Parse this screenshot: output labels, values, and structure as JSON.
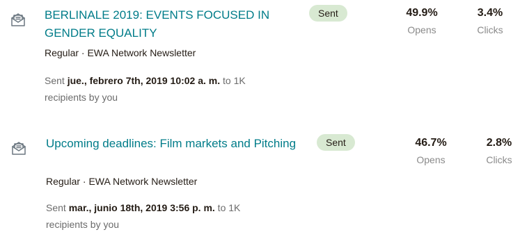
{
  "campaigns": [
    {
      "title": "BERLINALE 2019: EVENTS FOCUSED IN GENDER EQUALITY",
      "meta": "Regular · EWA Network Newsletter",
      "sent_prefix": "Sent ",
      "sent_date": "jue., febrero 7th, 2019 10:02 a. m.",
      "sent_suffix": " to 1K recipients by you",
      "status": "Sent",
      "opens_value": "49.9%",
      "opens_label": "Opens",
      "clicks_value": "3.4%",
      "clicks_label": "Clicks",
      "icon": "email-campaign-icon"
    },
    {
      "title": "Upcoming deadlines: Film markets and Pitching",
      "meta": "Regular · EWA Network Newsletter",
      "sent_prefix": "Sent ",
      "sent_date": "mar., junio 18th, 2019 3:56 p. m.",
      "sent_suffix": " to 1K recipients by you",
      "status": "Sent",
      "opens_value": "46.7%",
      "opens_label": "Opens",
      "clicks_value": "2.8%",
      "clicks_label": "Clicks",
      "icon": "email-campaign-icon"
    }
  ],
  "colors": {
    "title": "#007c89",
    "badge_bg": "#d8e9d2",
    "text": "#241c15",
    "muted": "#8a8a8a"
  }
}
